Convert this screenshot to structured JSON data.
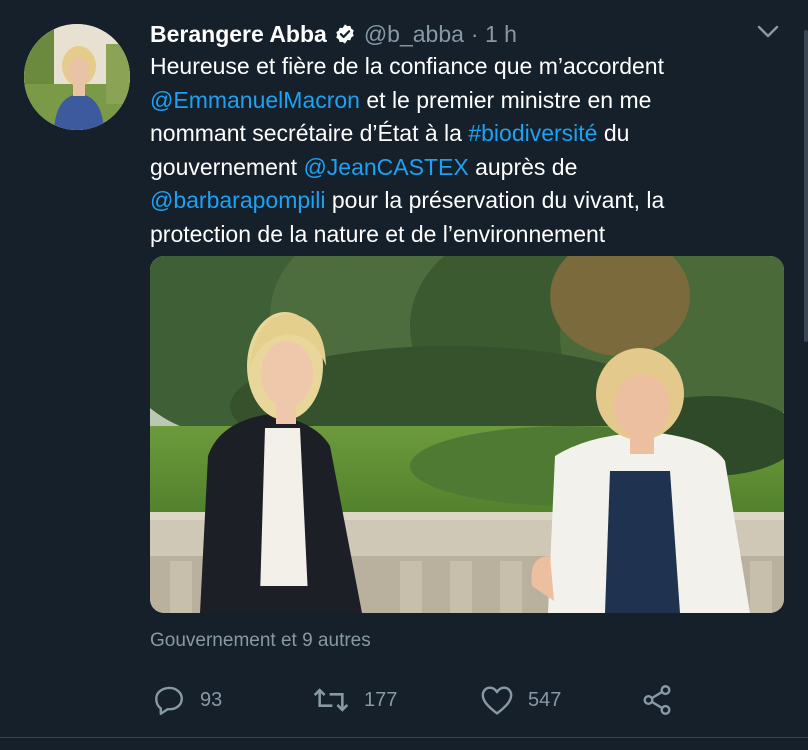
{
  "tweet": {
    "author_name": "Berangere Abba",
    "handle": "@b_abba",
    "time": "· 1 h",
    "text_lines": [
      [
        {
          "t": "Heureuse et fière de la confiance que m’accordent",
          "m": false
        }
      ],
      [
        {
          "t": "@EmmanuelMacron",
          "m": true
        },
        {
          "t": " et le premier ministre en me",
          "m": false
        }
      ],
      [
        {
          "t": "nommant secrétaire d’État à la ",
          "m": false
        },
        {
          "t": "#biodiversité",
          "m": true
        },
        {
          "t": " du",
          "m": false
        }
      ],
      [
        {
          "t": "gouvernement ",
          "m": false
        },
        {
          "t": "@JeanCASTEX",
          "m": true
        },
        {
          "t": " auprès de",
          "m": false
        }
      ],
      [
        {
          "t": "@barbarapompili",
          "m": true
        },
        {
          "t": " pour la préservation du vivant, la",
          "m": false
        }
      ],
      [
        {
          "t": "protection de la nature et de l’environnement",
          "m": false
        }
      ]
    ],
    "tagged": "Gouvernement et 9 autres"
  },
  "actions": {
    "replies": "93",
    "retweets": "177",
    "likes": "547"
  },
  "colors": {
    "background": "#15202b",
    "secondary_text": "#8899a6",
    "link": "#1da1f2"
  },
  "icons": {
    "verified": "verified-badge-icon",
    "menu": "chevron-down-icon",
    "reply": "reply-icon",
    "retweet": "retweet-icon",
    "like": "heart-icon",
    "share": "share-icon"
  }
}
